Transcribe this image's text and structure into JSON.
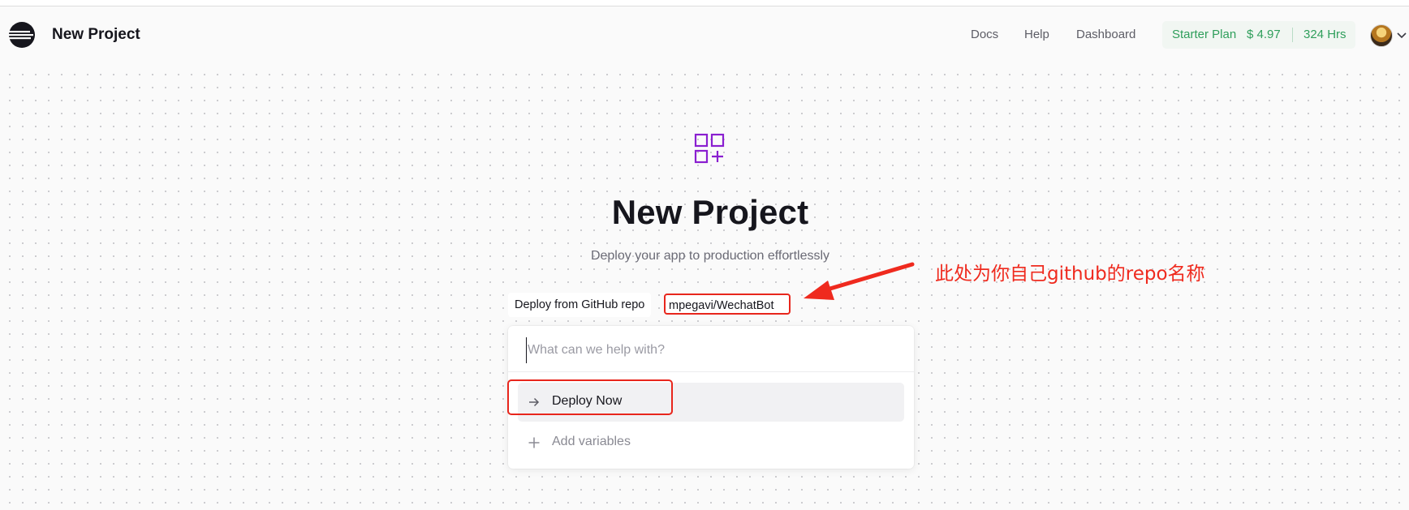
{
  "header": {
    "title": "New Project",
    "logo_icon": "railway-logo-icon",
    "nav": [
      "Docs",
      "Help",
      "Dashboard"
    ],
    "plan": {
      "name": "Starter Plan",
      "credit": "$ 4.97",
      "hours": "324 Hrs"
    },
    "avatar_icon": "user-avatar",
    "menu_icon": "chevron-down-icon"
  },
  "hero": {
    "icon": "grid-plus-icon",
    "title": "New Project",
    "subtitle": "Deploy your app to production effortlessly"
  },
  "breadcrumb": {
    "source": "Deploy from GitHub repo",
    "repo": "mpegavi/WechatBot"
  },
  "command": {
    "placeholder": "What can we help with?",
    "value": "",
    "items": [
      {
        "label": "Deploy Now",
        "icon": "arrow-right-icon",
        "highlighted": true
      },
      {
        "label": "Add variables",
        "icon": "plus-icon",
        "highlighted": false
      }
    ]
  },
  "annotation": {
    "text": "此处为你自己github的repo名称",
    "color": "#ef2a1e"
  },
  "colors": {
    "accent_purple": "#8a1fd0",
    "plan_green": "#2f9e5b",
    "annotation_red": "#ef2a1e"
  }
}
